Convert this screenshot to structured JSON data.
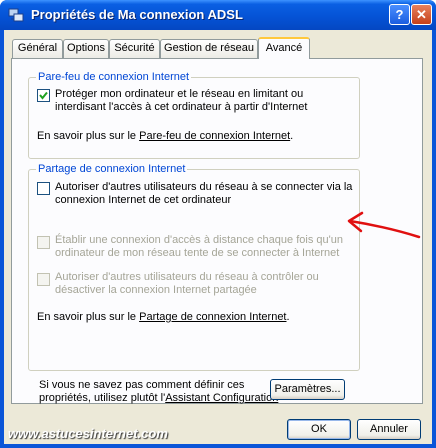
{
  "window": {
    "title": "Propriétés de Ma connexion ADSL",
    "help_label": "?",
    "close_label": "✕"
  },
  "tabs": [
    {
      "label": "Général"
    },
    {
      "label": "Options"
    },
    {
      "label": "Sécurité"
    },
    {
      "label": "Gestion de réseau"
    },
    {
      "label": "Avancé"
    }
  ],
  "firewall": {
    "group_label": "Pare-feu de connexion Internet",
    "checkbox_label": "Protéger mon ordinateur et le réseau en limitant ou interdisant l'accès à cet ordinateur à partir d'Internet",
    "checked": true,
    "learn_prefix": "En savoir plus sur le ",
    "learn_link": "Pare-feu de connexion Internet",
    "learn_suffix": "."
  },
  "sharing": {
    "group_label": "Partage de connexion Internet",
    "allow_label": "Autoriser d'autres utilisateurs du réseau à se connecter via la connexion Internet de cet ordinateur",
    "allow_checked": false,
    "dial_label": "Établir une connexion d'accès à distance chaque fois qu'un ordinateur de mon réseau tente de se connecter à Internet",
    "control_label": "Autoriser d'autres utilisateurs du réseau à contrôler ou désactiver la connexion Internet partagée",
    "learn_prefix": "En savoir plus sur le ",
    "learn_link": "Partage de connexion Internet",
    "learn_suffix": "."
  },
  "footer": {
    "hint_line1": "Si vous ne savez pas comment définir ces",
    "hint_prefix": "propriétés, utilisez plutôt l'",
    "hint_link": "Assistant Configuration",
    "settings_button": "Paramètres..."
  },
  "buttons": {
    "ok": "OK",
    "cancel": "Annuler"
  },
  "watermark": "www.astucesinternet.com",
  "colors": {
    "titlebar": "#0553d6",
    "group_label": "#0046d5",
    "annotation_arrow": "#e01010"
  }
}
